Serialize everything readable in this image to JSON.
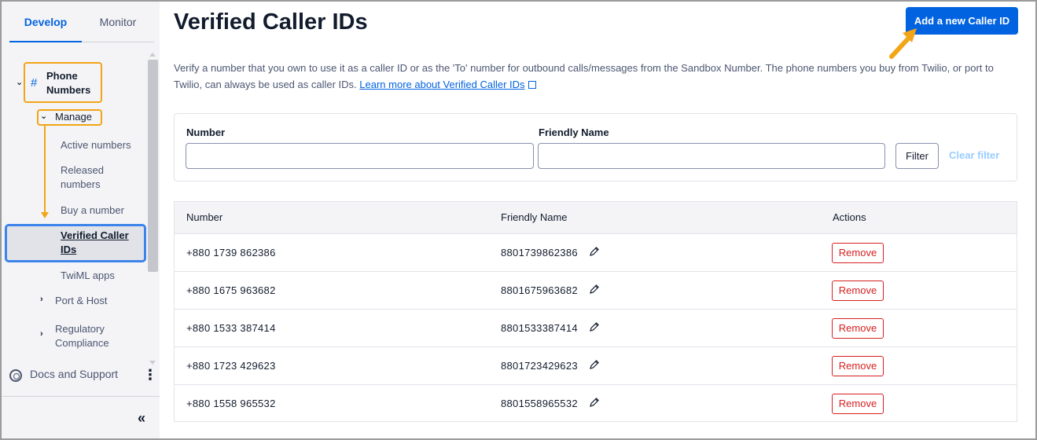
{
  "sidebar": {
    "tabs": [
      {
        "label": "Develop",
        "active": true
      },
      {
        "label": "Monitor",
        "active": false
      }
    ],
    "phone_numbers": {
      "line1": "Phone",
      "line2": "Numbers"
    },
    "manage": "Manage",
    "items": {
      "active_numbers": "Active numbers",
      "released_line1": "Released",
      "released_line2": "numbers",
      "buy": "Buy a number",
      "verified_line1": "Verified Caller",
      "verified_line2": "IDs",
      "twiml": "TwiML apps"
    },
    "port_host": "Port & Host",
    "regulatory_line1": "Regulatory",
    "regulatory_line2": "Compliance",
    "docs": "Docs and Support"
  },
  "header": {
    "title": "Verified Caller IDs",
    "add_button": "Add a new Caller ID"
  },
  "description": {
    "text": "Verify a number that you own to use it as a caller ID or as the 'To' number for outbound calls/messages from the Sandbox Number. The phone numbers you buy from Twilio, or port to Twilio, can always be used as caller IDs.",
    "link": "Learn more about Verified Caller IDs"
  },
  "filter": {
    "number_label": "Number",
    "friendly_label": "Friendly Name",
    "filter_button": "Filter",
    "clear_filter": "Clear filter"
  },
  "table": {
    "headers": {
      "number": "Number",
      "friendly": "Friendly Name",
      "actions": "Actions"
    },
    "rows": [
      {
        "number": "+880 1739 862386",
        "friendly": "8801739862386",
        "action": "Remove"
      },
      {
        "number": "+880 1675 963682",
        "friendly": "8801675963682",
        "action": "Remove"
      },
      {
        "number": "+880 1533 387414",
        "friendly": "8801533387414",
        "action": "Remove"
      },
      {
        "number": "+880 1723 429623",
        "friendly": "8801723429623",
        "action": "Remove"
      },
      {
        "number": "+880 1558 965532",
        "friendly": "8801558965532",
        "action": "Remove"
      }
    ]
  },
  "colors": {
    "accent": "#0263e0",
    "highlight_orange": "#f2a516",
    "highlight_blue": "#3d84ea",
    "destructive": "#d61f1f"
  }
}
